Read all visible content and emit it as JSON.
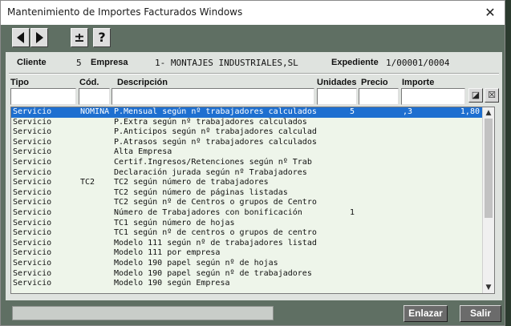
{
  "window": {
    "title": "Mantenimiento de Importes Facturados Windows",
    "close_glyph": "✕"
  },
  "toolbar": {
    "plusminus_glyph": "±",
    "help_glyph": "?"
  },
  "header": {
    "cliente_label": "Cliente",
    "cliente_value": "5",
    "empresa_label": "Empresa",
    "empresa_value": "1- MONTAJES INDUSTRIALES,SL",
    "expediente_label": "Expediente",
    "expediente_value": "1/00001/0004"
  },
  "columns": {
    "tipo": "Tipo",
    "cod": "Cód.",
    "descripcion": "Descripción",
    "unidades": "Unidades",
    "precio": "Precio",
    "importe": "Importe"
  },
  "rows": [
    {
      "tipo": "Servicio",
      "cod": "NOMINA",
      "desc": "P.Mensual según nº trabajadores calculados",
      "unidades": "5",
      "precio": ",3",
      "importe": "1,80",
      "selected": true
    },
    {
      "tipo": "Servicio",
      "cod": "",
      "desc": "P.Extra  según nº trabajadores calculados",
      "unidades": "",
      "precio": "",
      "importe": ""
    },
    {
      "tipo": "Servicio",
      "cod": "",
      "desc": "P.Anticipos según nº trabajadores calculad",
      "unidades": "",
      "precio": "",
      "importe": ""
    },
    {
      "tipo": "Servicio",
      "cod": "",
      "desc": "P.Atrasos según nº trabajadores calculados",
      "unidades": "",
      "precio": "",
      "importe": ""
    },
    {
      "tipo": "Servicio",
      "cod": "",
      "desc": "Alta Empresa",
      "unidades": "",
      "precio": "",
      "importe": ""
    },
    {
      "tipo": "Servicio",
      "cod": "",
      "desc": "Certif.Ingresos/Retenciones según nº Trab",
      "unidades": "",
      "precio": "",
      "importe": ""
    },
    {
      "tipo": "Servicio",
      "cod": "",
      "desc": "Declaración jurada según nº Trabajadores",
      "unidades": "",
      "precio": "",
      "importe": ""
    },
    {
      "tipo": "Servicio",
      "cod": "TC2",
      "desc": "TC2 según número de trabajadores",
      "unidades": "",
      "precio": "",
      "importe": ""
    },
    {
      "tipo": "Servicio",
      "cod": "",
      "desc": "TC2 según número de páginas listadas",
      "unidades": "",
      "precio": "",
      "importe": ""
    },
    {
      "tipo": "Servicio",
      "cod": "",
      "desc": "TC2 según nº de Centros o grupos de Centro",
      "unidades": "",
      "precio": "",
      "importe": ""
    },
    {
      "tipo": "Servicio",
      "cod": "",
      "desc": "Número de Trabajadores con bonificación",
      "unidades": "1",
      "precio": "",
      "importe": ""
    },
    {
      "tipo": "Servicio",
      "cod": "",
      "desc": "TC1 según número de hojas",
      "unidades": "",
      "precio": "",
      "importe": ""
    },
    {
      "tipo": "Servicio",
      "cod": "",
      "desc": "TC1 según nº de centros o grupos de centro",
      "unidades": "",
      "precio": "",
      "importe": ""
    },
    {
      "tipo": "Servicio",
      "cod": "",
      "desc": "Modelo 111 según nº de trabajadores listad",
      "unidades": "",
      "precio": "",
      "importe": ""
    },
    {
      "tipo": "Servicio",
      "cod": "",
      "desc": "Modelo 111 por empresa",
      "unidades": "",
      "precio": "",
      "importe": ""
    },
    {
      "tipo": "Servicio",
      "cod": "",
      "desc": "Modelo 190 papel según nº de hojas",
      "unidades": "",
      "precio": "",
      "importe": ""
    },
    {
      "tipo": "Servicio",
      "cod": "",
      "desc": "Modelo 190 papel según nº de trabajadores",
      "unidades": "",
      "precio": "",
      "importe": ""
    },
    {
      "tipo": "Servicio",
      "cod": "",
      "desc": "Modelo 190 según Empresa",
      "unidades": "",
      "precio": "",
      "importe": ""
    }
  ],
  "buttons": {
    "enlazar": "Enlazar",
    "salir": "Salir"
  },
  "colors": {
    "selection": "#1e6fd0",
    "grid_bg": "#eef5ea",
    "frame": "#5f6f63"
  }
}
